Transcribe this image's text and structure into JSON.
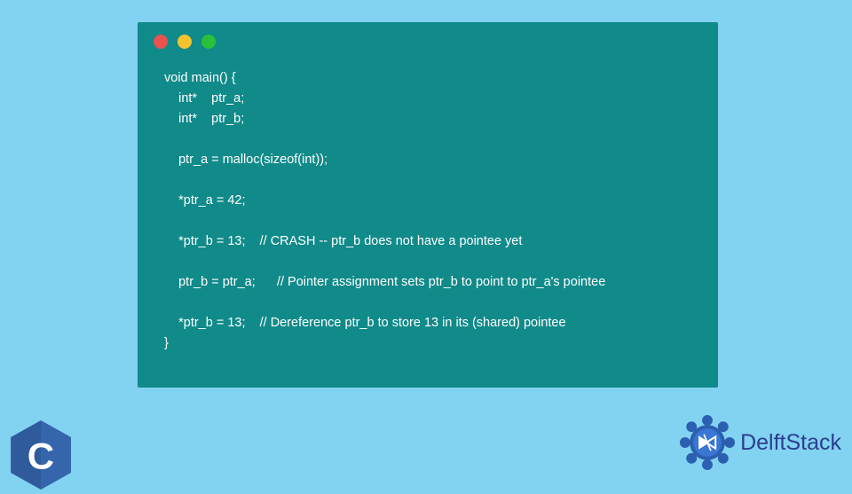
{
  "window": {
    "controls": [
      "red",
      "yellow",
      "green"
    ]
  },
  "code": {
    "lines": [
      "void main() {",
      "    int*    ptr_a;",
      "    int*    ptr_b;",
      "",
      "    ptr_a = malloc(sizeof(int));",
      "",
      "    *ptr_a = 42;",
      "",
      "    *ptr_b = 13;    // CRASH -- ptr_b does not have a pointee yet",
      "",
      "    ptr_b = ptr_a;      // Pointer assignment sets ptr_b to point to ptr_a's pointee",
      "",
      "    *ptr_b = 13;    // Dereference ptr_b to store 13 in its (shared) pointee",
      "}"
    ]
  },
  "logos": {
    "c_letter": "C",
    "brand": "DelftStack"
  },
  "colors": {
    "page_bg": "#82d2f2",
    "window_bg": "#118a8a",
    "code_text": "#ffffff",
    "dot_red": "#e9524f",
    "dot_yellow": "#f2c32f",
    "dot_green": "#2ac13a",
    "c_logo_blue": "#2f5a9c",
    "brand_blue": "#2b3e8f"
  }
}
